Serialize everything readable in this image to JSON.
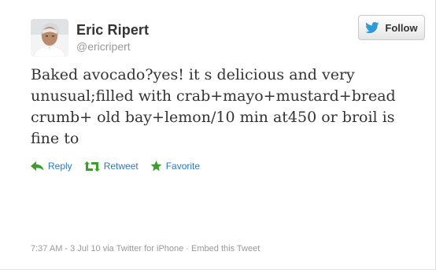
{
  "user": {
    "name": "Eric Ripert",
    "handle": "@ericripert"
  },
  "follow_button": {
    "label": "Follow",
    "icon": "twitter-bird-icon"
  },
  "tweet": {
    "text": "Baked avocado?yes! it s delicious and very unusual;filled with crab+mayo+mustard+bread crumb+ old bay+lemon/10 min at450 or broil is fine to"
  },
  "actions": [
    {
      "label": "Reply",
      "icon": "reply-arrow-icon"
    },
    {
      "label": "Retweet",
      "icon": "retweet-icon"
    },
    {
      "label": "Favorite",
      "icon": "star-icon"
    }
  ],
  "meta": {
    "time": "7:37 AM - 3 Jul 10",
    "via": "via Twitter for iPhone",
    "separator": "·",
    "embed": "Embed this Tweet"
  },
  "colors": {
    "action_green": "#3b9f2a",
    "action_blue": "#2b7bb9",
    "bird_blue": "#2f9ad8",
    "meta_gray": "#999999"
  }
}
